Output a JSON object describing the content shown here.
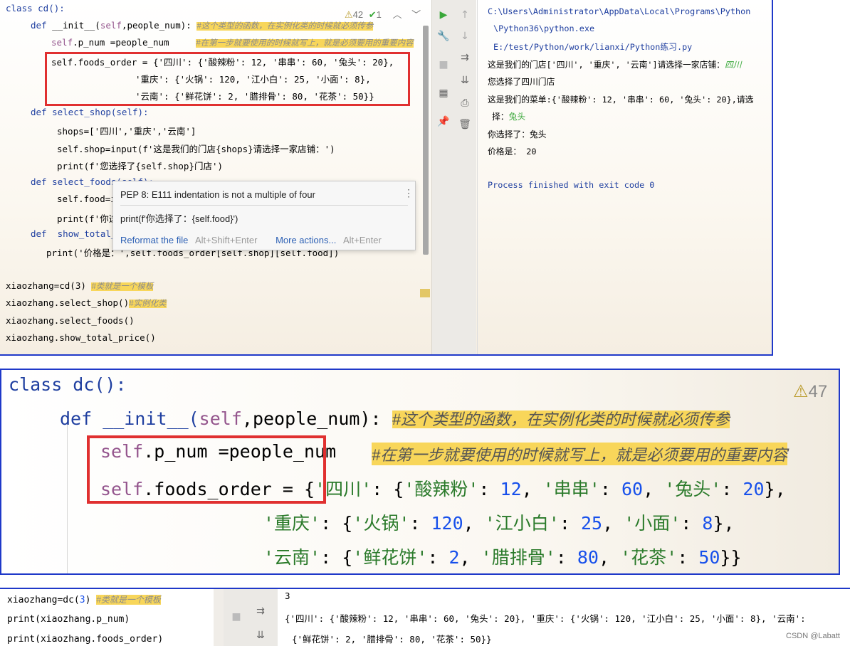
{
  "panel1": {
    "code": {
      "l1": "class cd():",
      "l2_kw": "def",
      "l2_fn": " __init__(",
      "l2_self": "self",
      "l2_rest": ",people_num): ",
      "l2_cmt": "#这个类型的函数，在实例化类的时候就必须传参",
      "l3_self": "self",
      "l3_rest": ".p_num =people_num     ",
      "l3_cmt": "#在第一步就要使用的时候就写上，就是必须要用的重要内容",
      "l4": "self.foods_order = {'四川': {'酸辣粉': 12, '串串': 60, '兔头': 20},",
      "l5": "'重庆': {'火锅': 120, '江小白': 25, '小面': 8},",
      "l6": "'云南': {'鲜花饼': 2, '腊排骨': 80, '花茶': 50}}",
      "l7": "def select_shop(self):",
      "l8": "shops=['四川','重庆','云南']",
      "l9": "self.shop=input(f'这是我们的门店{shops}请选择一家店铺：')",
      "l10": "print(f'您选择了{self.shop}门店')",
      "l11": "def select_foods(self):",
      "l12": "self.food=i",
      "l13": "print(f'你选",
      "l14": "def  show_total_",
      "l15": "print('价格是：',self.foods_order[self.shop][self.food])",
      "l16_code": "xiaozhang=cd(3) ",
      "l16_cmt": "#类就是一个模板",
      "l17_code": "xiaozhang.select_shop()",
      "l17_cmt": "#实例化类",
      "l18": "xiaozhang.select_foods()",
      "l19": "xiaozhang.show_total_price()"
    },
    "inspections": {
      "warnings": "42",
      "weak": "1"
    },
    "tooltip": {
      "title": "PEP 8: E111 indentation is not a multiple of four",
      "code": "print(f'你选择了：{self.food}')",
      "reformat": "Reformat the file",
      "reformat_shortcut": "Alt+Shift+Enter",
      "more": "More actions...",
      "more_shortcut": "Alt+Enter"
    },
    "console": {
      "path1": "C:\\Users\\Administrator\\AppData\\Local\\Programs\\Python",
      "path2": "\\Python36\\python.exe",
      "path3": "E:/test/Python/work/lianxi/Python练习.py",
      "out1": "这是我们的门店['四川', '重庆', '云南']请选择一家店铺：",
      "in1": "四川",
      "out2": "您选择了四川门店",
      "out3": "这是我们的菜单:{'酸辣粉': 12, '串串': 60, '兔头': 20},请选",
      "out3b": "择：",
      "in2": "兔头",
      "out4": "你选择了：兔头",
      "out5": "价格是： 20",
      "exit": "Process finished with exit code 0"
    }
  },
  "panel2": {
    "l1": "class dc():",
    "warnings": "47",
    "l2_kw": "def",
    "l2_fn": " __init__(",
    "l2_self": "self",
    "l2_rest": ",people_num): ",
    "l2_cmt": "#这个类型的函数，在实例化类的时候就必须传参",
    "l3_self": "self",
    "l3_rest": ".p_num =people_num",
    "l3_cmt": "#在第一步就要使用的时候就写上，就是必须要用的重要内容",
    "l4_self": "self",
    "l4_rest": ".foods_order = {",
    "l4_s1": "'四川'",
    "l4_a": ": {",
    "l4_s2": "'酸辣粉'",
    "l4_b": ": ",
    "l4_n1": "12",
    "l4_c": ", ",
    "l4_s3": "'串串'",
    "l4_d": ": ",
    "l4_n2": "60",
    "l4_e": ", ",
    "l4_s4": "'兔头'",
    "l4_f": ": ",
    "l4_n3": "20",
    "l4_g": "},",
    "l5_s1": "'重庆'",
    "l5_a": ": {",
    "l5_s2": "'火锅'",
    "l5_b": ": ",
    "l5_n1": "120",
    "l5_c": ", ",
    "l5_s3": "'江小白'",
    "l5_d": ": ",
    "l5_n2": "25",
    "l5_e": ", ",
    "l5_s4": "'小面'",
    "l5_f": ": ",
    "l5_n3": "8",
    "l5_g": "},",
    "l6_s1": "'云南'",
    "l6_a": ": {",
    "l6_s2": "'鲜花饼'",
    "l6_b": ": ",
    "l6_n1": "2",
    "l6_c": ", ",
    "l6_s3": "'腊排骨'",
    "l6_d": ": ",
    "l6_n2": "80",
    "l6_e": ", ",
    "l6_s4": "'花茶'",
    "l6_f": ": ",
    "l6_n3": "50",
    "l6_g": "}}"
  },
  "panel3": {
    "l1_code": "xiaozhang=dc(",
    "l1_num": "3",
    "l1_end": ") ",
    "l1_cmt": "#类就是一个模板",
    "l2": "print(xiaozhang.p_num)",
    "l3": "print(xiaozhang.foods_order)",
    "out1": "3",
    "out2": "{'四川': {'酸辣粉': 12, '串串': 60, '兔头': 20}, '重庆': {'火锅': 120, '江小白': 25, '小面': 8}, '云南':",
    "out3": "{'鲜花饼': 2, '腊排骨': 80, '花茶': 50}}",
    "watermark": "CSDN @Labatt"
  },
  "colors": {
    "border_blue": "#1f39c9",
    "highlight_red": "#e03030",
    "comment_bg": "#f8d65a",
    "run_green": "#3aa83a"
  }
}
